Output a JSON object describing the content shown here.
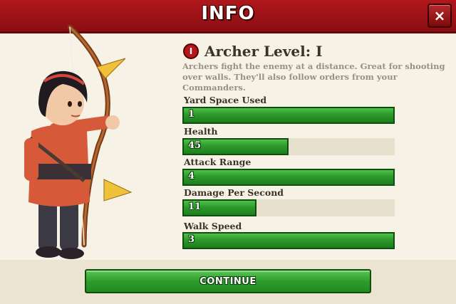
{
  "header": {
    "title": "INFO",
    "close_label": "×"
  },
  "unit": {
    "level_badge": "I",
    "name": "Archer Level: I",
    "description": "Archers fight the enemy at a distance. Great for shooting over walls. They'll also follow orders from your Commanders."
  },
  "stats": [
    {
      "label": "Yard Space Used",
      "value": "1",
      "fill_fraction": 1.0
    },
    {
      "label": "Health",
      "value": "45",
      "fill_fraction": 0.5
    },
    {
      "label": "Attack Range",
      "value": "4",
      "fill_fraction": 1.0
    },
    {
      "label": "Damage Per Second",
      "value": "11",
      "fill_fraction": 0.35
    },
    {
      "label": "Walk Speed",
      "value": "3",
      "fill_fraction": 1.0
    }
  ],
  "footer": {
    "continue_label": "CONTINUE"
  },
  "colors": {
    "header_red": "#b0171b",
    "bar_green": "#2c9a2a",
    "track": "#e7e0cc"
  },
  "icons": {
    "close": "close-icon",
    "hero": "archer-character"
  }
}
